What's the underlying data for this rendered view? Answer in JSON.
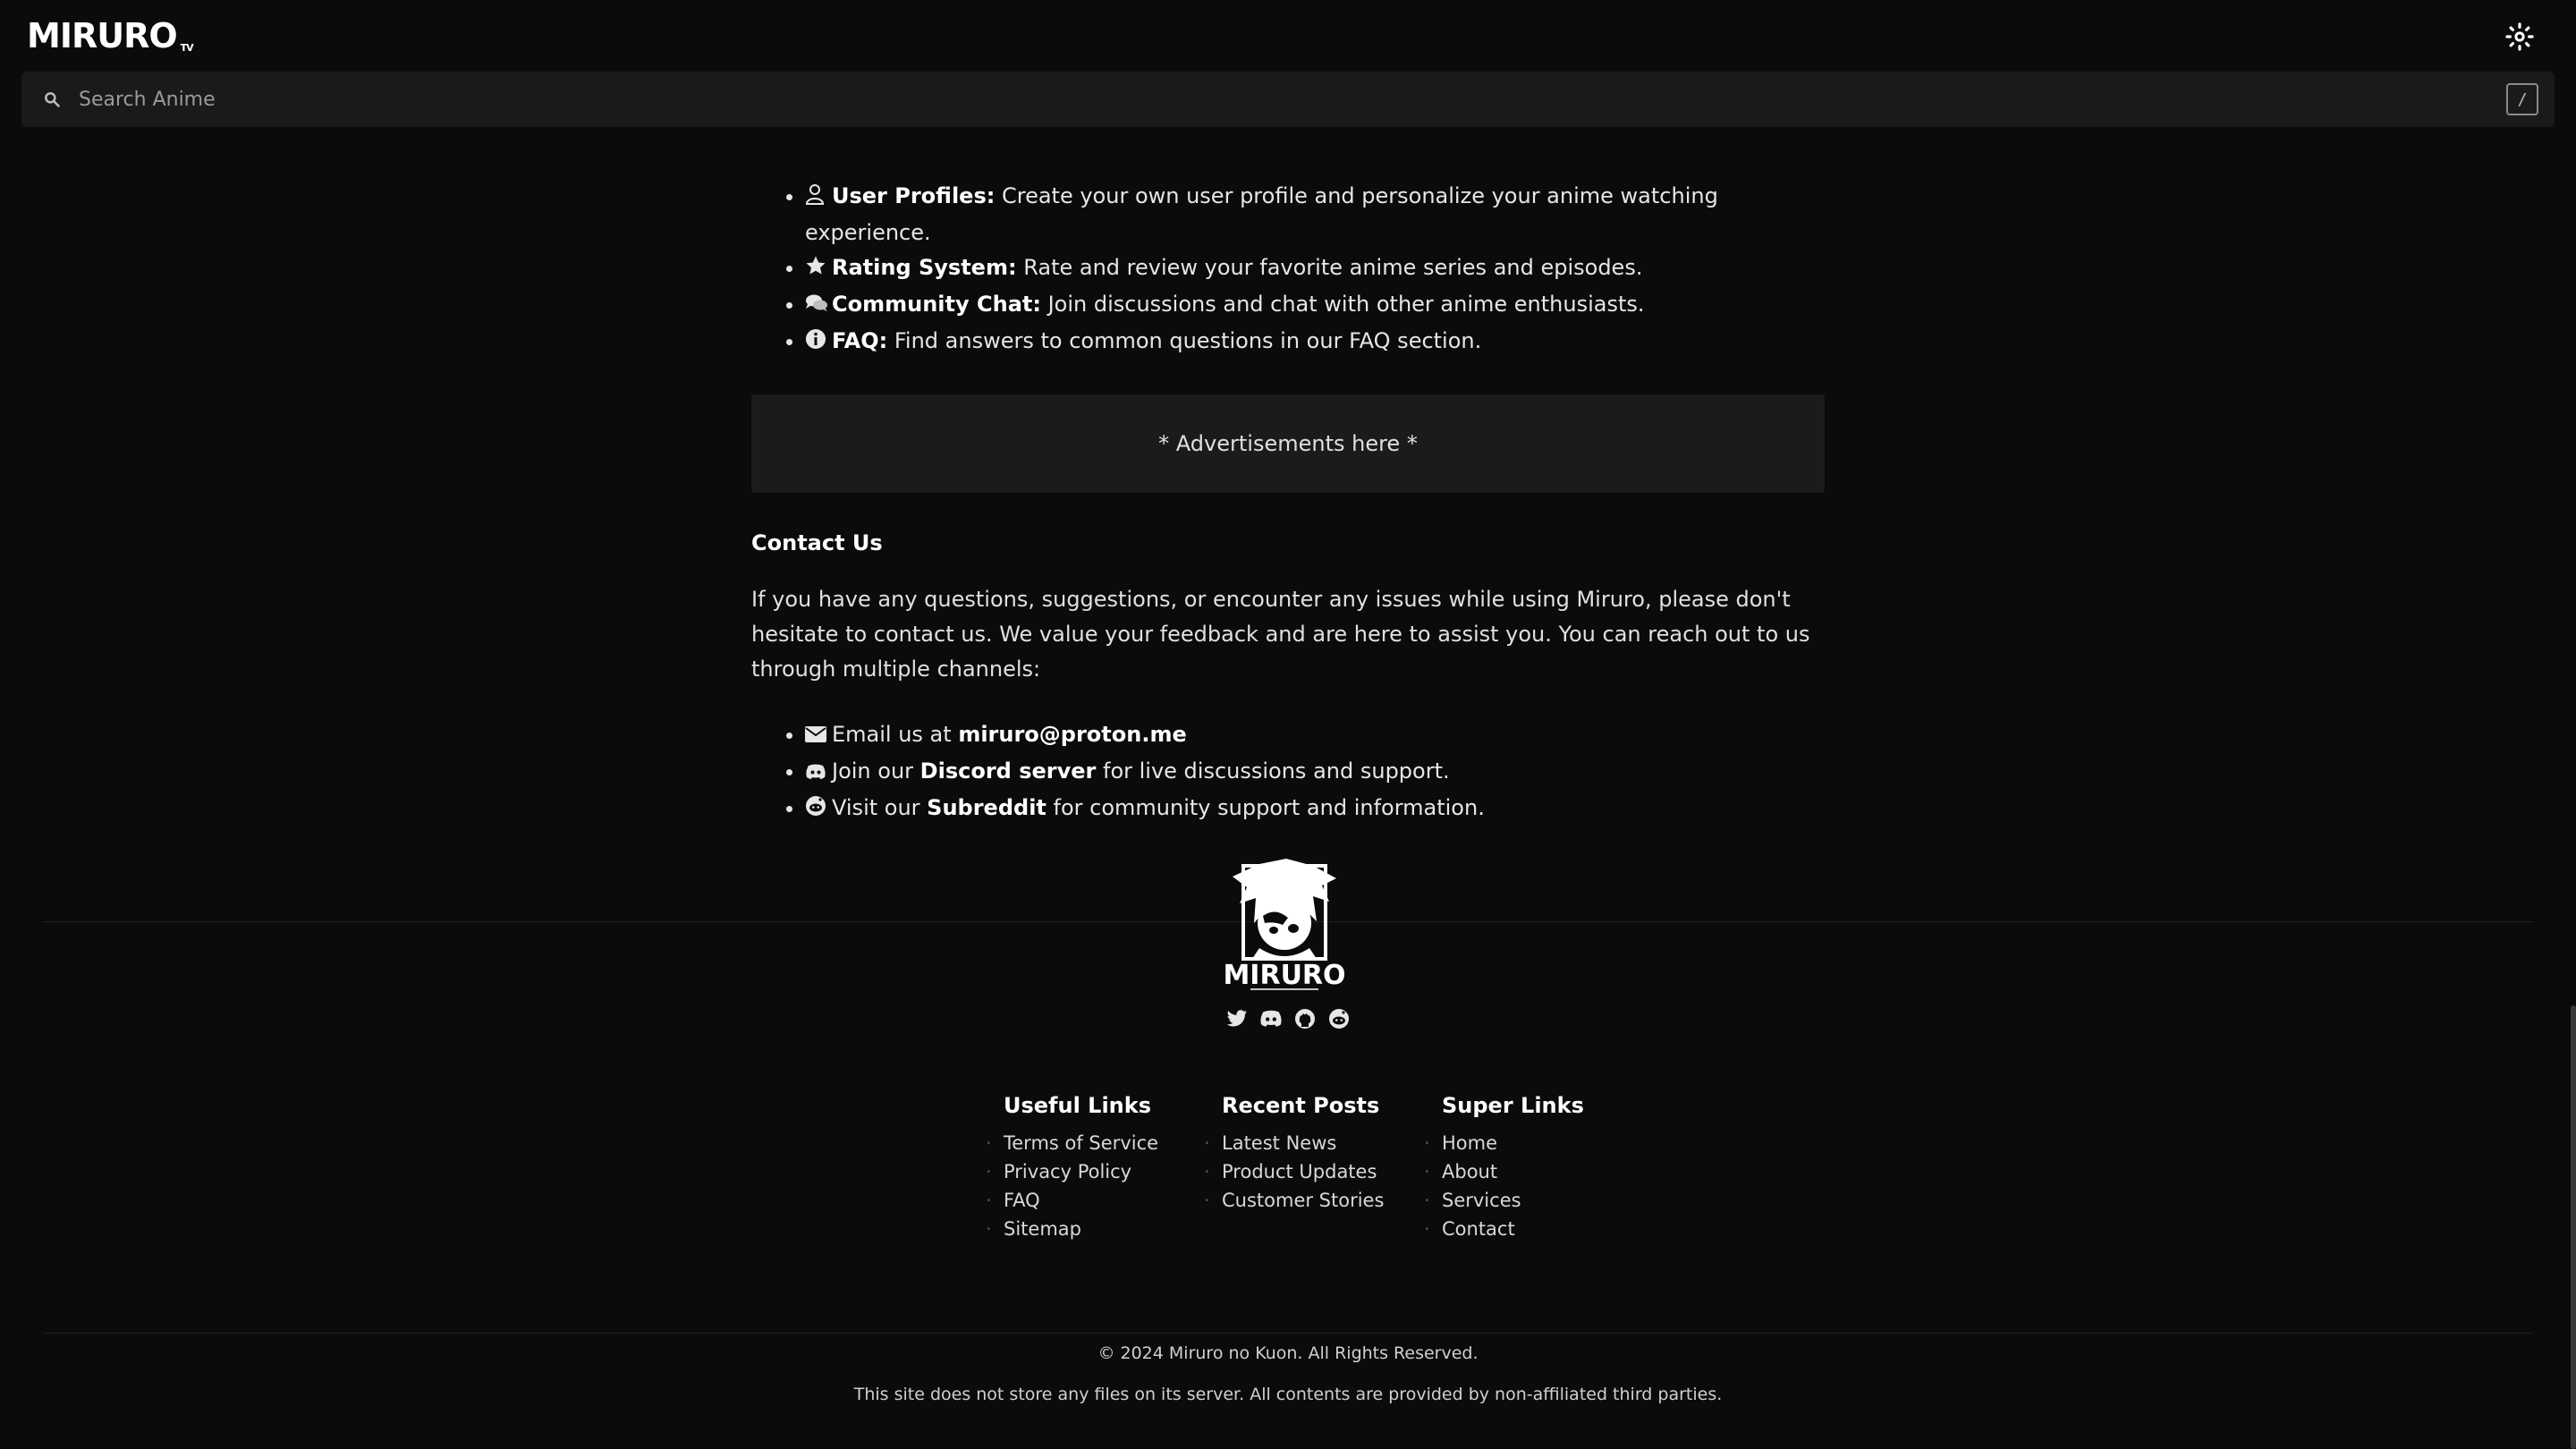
{
  "header": {
    "logo": "MIRURO",
    "logo_suffix": "TV",
    "theme_toggle_icon": "sun-icon"
  },
  "search": {
    "placeholder": "Search Anime",
    "shortcut_hint": "/"
  },
  "features": [
    {
      "icon": "user-icon",
      "title": "User Profiles:",
      "text": " Create your own user profile and personalize your anime watching experience."
    },
    {
      "icon": "star-icon",
      "title": "Rating System:",
      "text": " Rate and review your favorite anime series and episodes."
    },
    {
      "icon": "chat-icon",
      "title": "Community Chat:",
      "text": " Join discussions and chat with other anime enthusiasts."
    },
    {
      "icon": "info-icon",
      "title": "FAQ:",
      "text": " Find answers to common questions in our FAQ section."
    }
  ],
  "ad_text": "* Advertisements here *",
  "contact": {
    "title": "Contact Us",
    "text": "If you have any questions, suggestions, or encounter any issues while using Miruro, please don't hesitate to contact us. We value your feedback and are here to assist you. You can reach out to us through multiple channels:",
    "items": [
      {
        "icon": "envelope-icon",
        "before": "Email us at ",
        "bold": "miruro@proton.me",
        "after": ""
      },
      {
        "icon": "discord-icon",
        "before": "Join our ",
        "bold": "Discord server",
        "after": " for live discussions and support."
      },
      {
        "icon": "reddit-icon",
        "before": "Visit our ",
        "bold": "Subreddit",
        "after": " for community support and information."
      }
    ]
  },
  "footer": {
    "mascot_label": "MIRURO",
    "socials": [
      "twitter-icon",
      "discord-icon",
      "github-icon",
      "reddit-icon"
    ],
    "columns": [
      {
        "title": "Useful Links",
        "links": [
          "Terms of Service",
          "Privacy Policy",
          "FAQ",
          "Sitemap"
        ]
      },
      {
        "title": "Recent Posts",
        "links": [
          "Latest News",
          "Product Updates",
          "Customer Stories"
        ]
      },
      {
        "title": "Super Links",
        "links": [
          "Home",
          "About",
          "Services",
          "Contact"
        ]
      }
    ],
    "copyright": "© 2024 Miruro no Kuon. All Rights Reserved.",
    "disclaimer": "This site does not store any files on its server. All contents are provided by non-affiliated third parties."
  }
}
